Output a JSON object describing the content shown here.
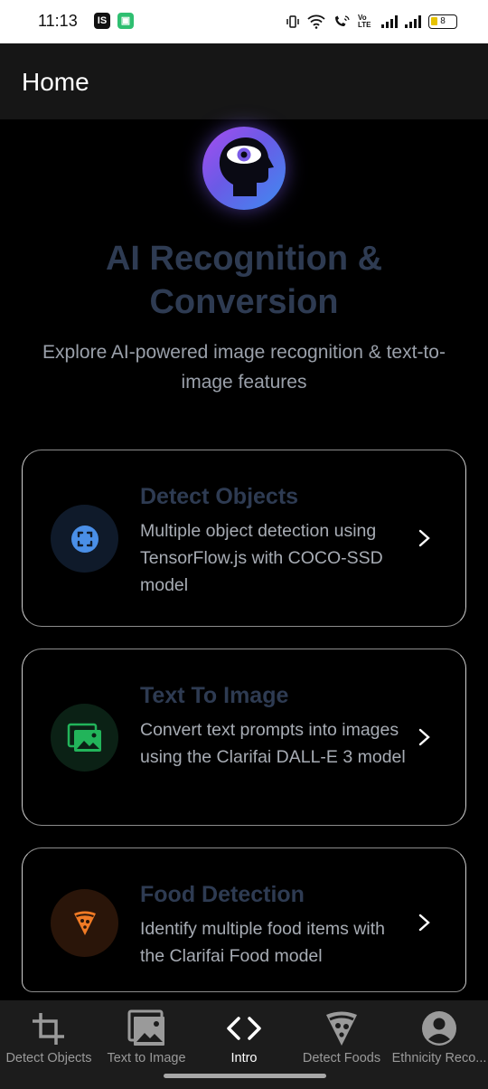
{
  "status_bar": {
    "time": "11:13",
    "app_badges": [
      "IS",
      "▣"
    ],
    "network_label": "Vo LTE",
    "battery_level": "8"
  },
  "app_bar": {
    "title": "Home"
  },
  "hero": {
    "title": "AI Recognition & Conversion",
    "subtitle": "Explore AI-powered image recognition & text-to-image features",
    "icon": "head-eye-icon"
  },
  "cards": [
    {
      "title": "Detect Objects",
      "description": "Multiple object detection using TensorFlow.js with COCO-SSD model",
      "icon": "object-scan-icon",
      "accent": "#4a8fe7",
      "icon_bg": "#0f1a2a"
    },
    {
      "title": "Text To Image",
      "description": "Convert text prompts into images using the Clarifai DALL-E 3 model",
      "icon": "image-gallery-icon",
      "accent": "#22b45a",
      "icon_bg": "#0b2115"
    },
    {
      "title": "Food Detection",
      "description": "Identify multiple food items with the Clarifai Food model",
      "icon": "pizza-slice-icon",
      "accent": "#f07a25",
      "icon_bg": "#2a1509"
    }
  ],
  "bottom_nav": {
    "items": [
      {
        "label": "Detect Objects",
        "icon": "crop-icon",
        "active": false
      },
      {
        "label": "Text to Image",
        "icon": "image-icon",
        "active": false
      },
      {
        "label": "Intro",
        "icon": "code-icon",
        "active": true
      },
      {
        "label": "Detect Foods",
        "icon": "pizza-icon",
        "active": false
      },
      {
        "label": "Ethnicity Reco...",
        "icon": "account-circle-icon",
        "active": false
      }
    ]
  },
  "colors": {
    "background": "#000000",
    "app_bar": "#161616",
    "title_text": "#2e3b52",
    "muted_text": "#a7acb4",
    "nav_bg": "#1c1c1c"
  }
}
